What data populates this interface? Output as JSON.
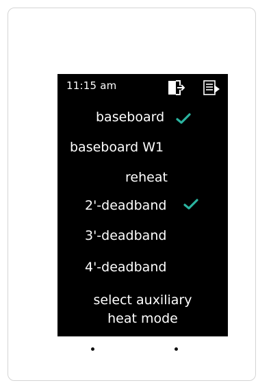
{
  "status_bar": {
    "time": "11:15 am",
    "icons": [
      "door-exit-icon",
      "menu-list-icon"
    ]
  },
  "menu": {
    "items": [
      {
        "label": "baseboard",
        "checked": true
      },
      {
        "label": "baseboard W1",
        "checked": false
      },
      {
        "label": "reheat",
        "checked": false
      },
      {
        "label": "2'-deadband",
        "checked": true
      },
      {
        "label": "3'-deadband",
        "checked": false
      },
      {
        "label": "4'-deadband",
        "checked": false
      }
    ],
    "footer_line1": "select auxiliary",
    "footer_line2": "heat mode"
  },
  "colors": {
    "screen_bg": "#000000",
    "text": "#ffffff",
    "check": "#2bb4a0",
    "device_border": "#d4d4d4"
  }
}
